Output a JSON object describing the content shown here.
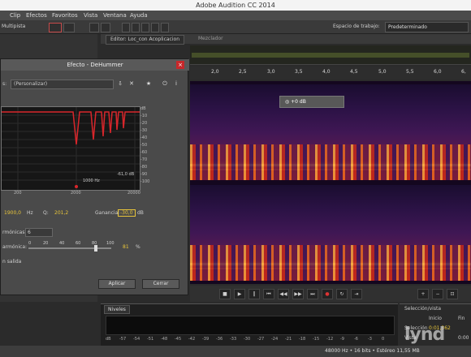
{
  "window": {
    "title": "Adobe Audition CC 2014"
  },
  "menu": {
    "items": [
      "Clip",
      "Efectos",
      "Favoritos",
      "Vista",
      "Ventana",
      "Ayuda"
    ]
  },
  "toolbar": {
    "workspace_label": "Espacio de trabajo:",
    "workspace_value": "Predeterminado",
    "multitrack_label": "Multipista"
  },
  "editor": {
    "tab_label": "Editor: Loc_con Acoplicacion",
    "mixer_label": "Mezclador"
  },
  "ruler": {
    "ticks": [
      "2,0",
      "2,5",
      "3,0",
      "3,5",
      "4,0",
      "4,5",
      "5,0",
      "5,5",
      "6,0",
      "6,"
    ]
  },
  "hud": {
    "value": "+0 dB"
  },
  "dialog": {
    "title": "Efecto - DeHummer",
    "preset_label": "s:",
    "preset_value": "(Personalizar)",
    "db_scale": [
      "dB",
      "-10",
      "-20",
      "-30",
      "-40",
      "-50",
      "-60",
      "-70",
      "-80",
      "-90",
      "-100"
    ],
    "freq_scale": [
      "200",
      "2000",
      "20000"
    ],
    "graph_freq_label": "1000 Hz",
    "graph_db_label": "-61,0 dB",
    "frequency_value": "1900,0",
    "hz_label": "Hz",
    "q_label": "Q:",
    "q_value": "201,2",
    "gain_label": "Ganancia:",
    "gain_value": "-30,0",
    "gain_unit": "dB",
    "harmonics_label": "rmónicas:",
    "harmonics_value": "6",
    "slope_label": "armónica:",
    "slope_ticks": [
      "0",
      "20",
      "40",
      "60",
      "80",
      "100"
    ],
    "slope_value": "81",
    "slope_unit": "%",
    "output_label": "n salida",
    "apply_button": "Aplicar",
    "close_button": "Cerrar"
  },
  "levels": {
    "tab_label": "Niveles",
    "scale": [
      "dB",
      "-57",
      "-54",
      "-51",
      "-48",
      "-45",
      "-42",
      "-39",
      "-36",
      "-33",
      "-30",
      "-27",
      "-24",
      "-21",
      "-18",
      "-15",
      "-12",
      "-9",
      "-6",
      "-3",
      "0"
    ]
  },
  "selection_panel": {
    "title": "Selección/vista",
    "start_header": "Inicio",
    "end_header": "Fin",
    "selection_label": "Selección",
    "selection_value": "0:01,362",
    "view_label": "Vista",
    "view_value": "0:00"
  },
  "status": {
    "text": "48000 Hz • 16 bits • Estéreo   11,55 MB"
  },
  "watermark": {
    "text": "lynd"
  },
  "colors": {
    "accent": "#e8c53a",
    "close": "#c6282b",
    "hum": "#f7d774",
    "curve": "#d8262b"
  }
}
